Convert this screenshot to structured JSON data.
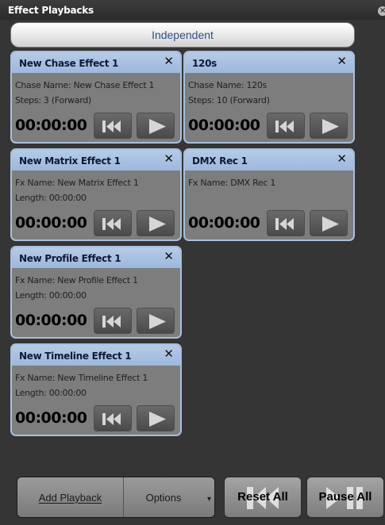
{
  "panel": {
    "title": "Effect Playbacks"
  },
  "mode_button": {
    "label": "Independent"
  },
  "cards": [
    {
      "title": "New Chase Effect 1",
      "line1": "Chase Name: New Chase Effect 1",
      "line2": "Steps: 3 (Forward)",
      "timer": "00:00:00"
    },
    {
      "title": "120s",
      "line1": "Chase Name: 120s",
      "line2": "Steps: 10 (Forward)",
      "timer": "00:00:00"
    },
    {
      "title": "New Matrix Effect 1",
      "line1": "Fx Name: New Matrix Effect 1",
      "line2": "Length: 00:00:00",
      "timer": "00:00:00"
    },
    {
      "title": "DMX Rec 1",
      "line1": "Fx Name: DMX Rec 1",
      "line2": "",
      "timer": "00:00:00"
    },
    {
      "title": "New Profile Effect 1",
      "line1": "Fx Name: New Profile Effect 1",
      "line2": "Length: 00:00:00",
      "timer": "00:00:00"
    },
    {
      "title": "New Timeline Effect 1",
      "line1": "Fx Name: New Timeline Effect 1",
      "line2": "Length: 00:00:00",
      "timer": "00:00:00"
    }
  ],
  "card_close_glyph": "✕",
  "bottom": {
    "add_playback": "Add Playback",
    "options": "Options",
    "reset_all": "Reset All",
    "pause_all": "Pause All"
  },
  "colors": {
    "card_header": "#a9c2e3",
    "card_body": "#7d7d7d",
    "background": "#353535",
    "mode_text": "#334e88"
  },
  "icons": {
    "rewind": "rewind-to-start-icon",
    "play": "play-icon",
    "close": "close-icon"
  }
}
